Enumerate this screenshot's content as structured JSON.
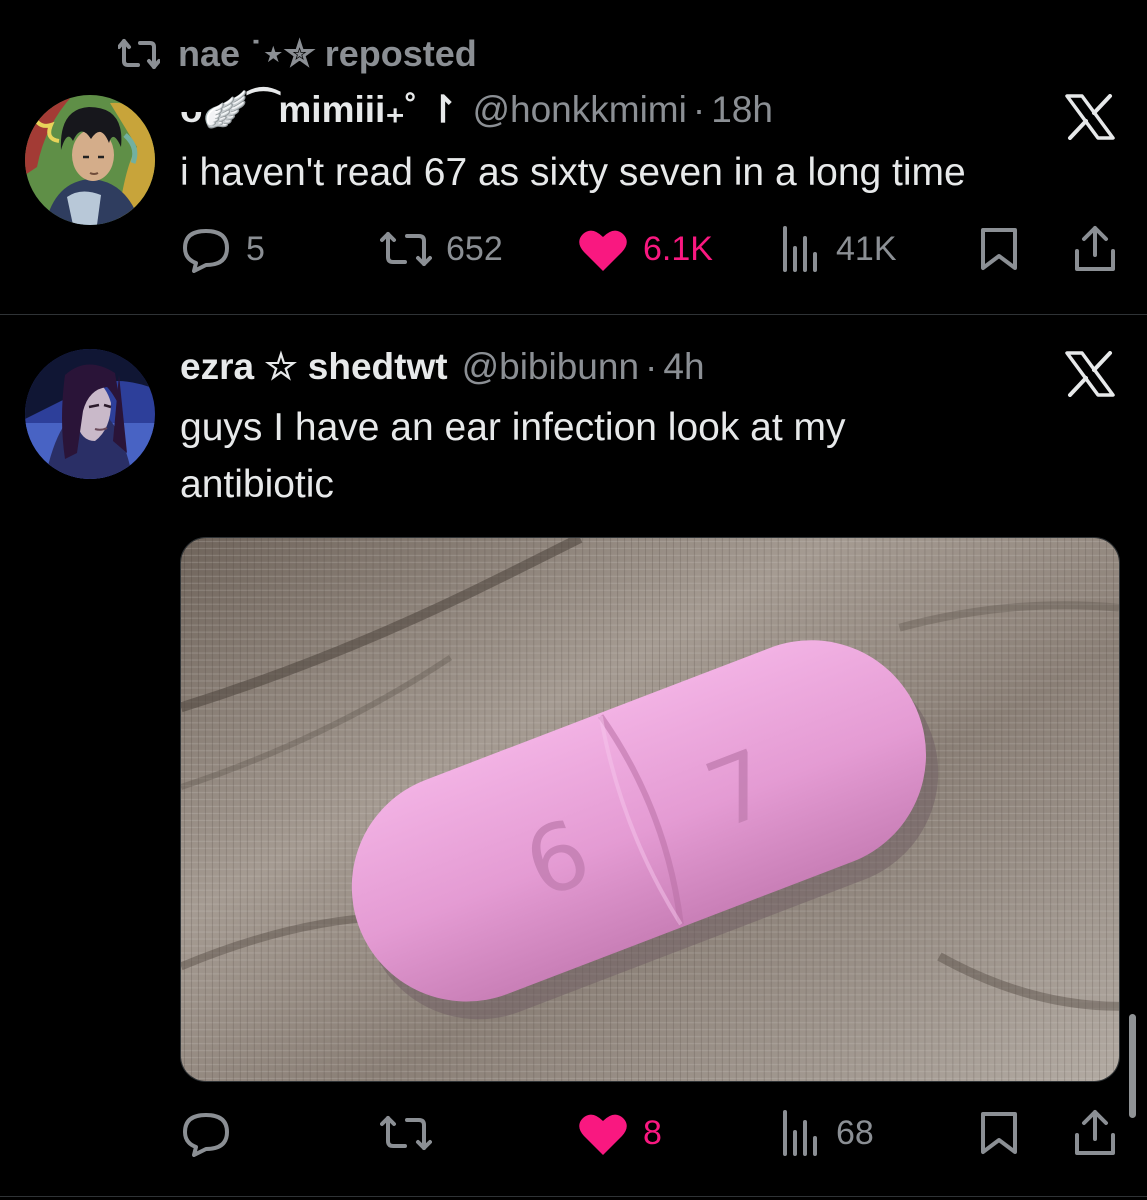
{
  "repost": {
    "label": "nae ˙⋆✮ reposted"
  },
  "posts": [
    {
      "display_name": "ᴗ🪽⁀mimiii₊˚ ↾",
      "handle": "@honkkmimi",
      "separator": "·",
      "time": "18h",
      "text": "i haven't read 67 as sixty seven in a long time",
      "stats": {
        "replies": "5",
        "reposts": "652",
        "likes": "6.1K",
        "views": "41K"
      }
    },
    {
      "display_name": "ezra ☆ shedtwt",
      "handle": "@bibibunn",
      "separator": "·",
      "time": "4h",
      "text": "guys I have an ear infection look at my antibiotic",
      "media": {
        "description": "pink capsule-shaped pill",
        "imprint_left": "6",
        "imprint_right": "7"
      },
      "stats": {
        "replies": "",
        "reposts": "",
        "likes": "8",
        "views": "68"
      }
    }
  ],
  "colors": {
    "background": "#000000",
    "text": "#e7e9ea",
    "muted": "#8b8f94",
    "like": "#f91880",
    "divider": "#2f3336"
  },
  "icons": [
    "repost-icon",
    "x-logo-icon",
    "reply-icon",
    "like-icon",
    "views-icon",
    "bookmark-icon",
    "share-icon"
  ]
}
